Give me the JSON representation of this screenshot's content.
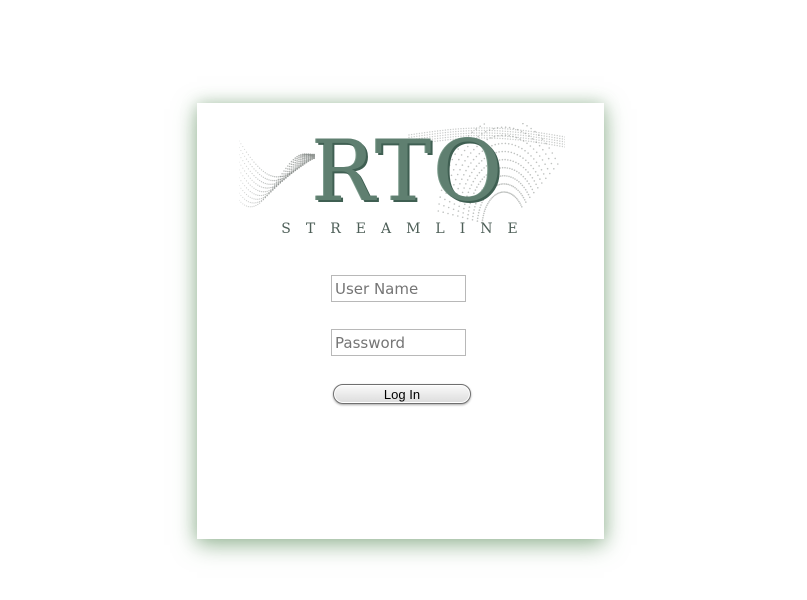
{
  "logo": {
    "word": "RTO",
    "subtitle": "STREAMLINE"
  },
  "form": {
    "username_placeholder": "User Name",
    "username_value": "",
    "password_placeholder": "Password",
    "password_value": "",
    "login_label": "Log In"
  },
  "colors": {
    "logo_text": "#5f7f70",
    "card_shadow": "#6fa06f",
    "wave_dots": "#8a8f8c"
  }
}
